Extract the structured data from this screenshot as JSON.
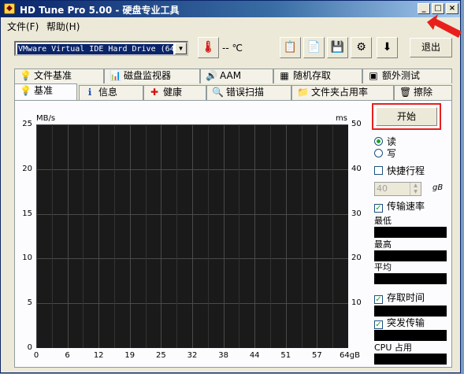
{
  "window": {
    "title": "HD Tune Pro 5.00 - 硬盘专业工具",
    "controls": {
      "minimize": "_",
      "maximize": "□",
      "close": "×"
    }
  },
  "menu": [
    "文件(F)",
    "帮助(H)"
  ],
  "toolbar": {
    "drive": "VMware Virtual IDE Hard Drive (64",
    "temperature": "-- ℃",
    "exit_label": "退出",
    "icons": [
      "thermometer-icon",
      "copy-text-icon",
      "copy-screen-icon",
      "save-icon",
      "options-icon",
      "download-icon"
    ]
  },
  "tabs_top": [
    {
      "label": "文件基准",
      "icon": "💡"
    },
    {
      "label": "磁盘监视器",
      "icon": "📊"
    },
    {
      "label": "AAM",
      "icon": "🔊"
    },
    {
      "label": "随机存取",
      "icon": "▦"
    },
    {
      "label": "额外测试",
      "icon": "▣"
    }
  ],
  "tabs_bottom": [
    {
      "label": "基准",
      "icon": "💡",
      "active": true
    },
    {
      "label": "信息",
      "icon": "ℹ"
    },
    {
      "label": "健康",
      "icon": "✚"
    },
    {
      "label": "错误扫描",
      "icon": "🔍"
    },
    {
      "label": "文件夹占用率",
      "icon": "📁"
    },
    {
      "label": "擦除",
      "icon": "🗑"
    }
  ],
  "chart_data": {
    "type": "line",
    "xlabel": "",
    "ylabel_left": "MB/s",
    "ylabel_right": "ms",
    "x_ticks": [
      "0",
      "6",
      "12",
      "19",
      "25",
      "32",
      "38",
      "44",
      "51",
      "57",
      "64gB"
    ],
    "y_left_ticks": [
      "25",
      "20",
      "15",
      "10",
      "5",
      "0"
    ],
    "y_right_ticks": [
      "50",
      "40",
      "30",
      "20",
      "10",
      ""
    ],
    "ylim_left": [
      0,
      25
    ],
    "ylim_right": [
      0,
      50
    ],
    "xlim": [
      0,
      64
    ],
    "grid": true,
    "series": []
  },
  "side": {
    "start_label": "开始",
    "read_label": "读",
    "write_label": "写",
    "quick_label": "快捷行程",
    "quick_value": "40",
    "quick_unit": "gB",
    "transfer_label": "传输速率",
    "min_label": "最低",
    "max_label": "最高",
    "avg_label": "平均",
    "access_label": "存取时间",
    "burst_label": "突发传输",
    "cpu_label": "CPU 占用"
  },
  "colors": {
    "highlight": "#e8201c",
    "plot_bg": "#1a1a1a",
    "grid": "#4a4a4a"
  }
}
